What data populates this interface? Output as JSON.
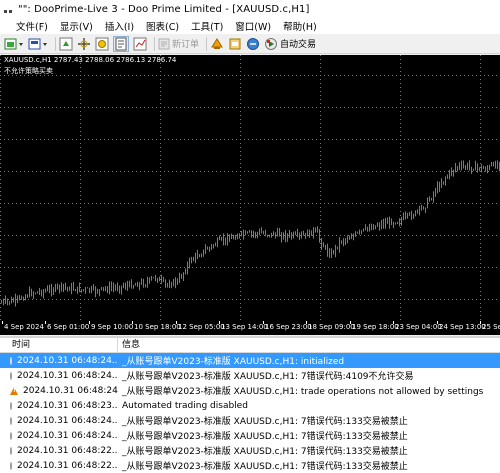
{
  "window": {
    "title": "\"\": DooPrime-Live 3 - Doo Prime Limited - [XAUUSD.c,H1]"
  },
  "menu": {
    "items": [
      "文件(F)",
      "显示(V)",
      "插入(I)",
      "图表(C)",
      "工具(T)",
      "窗口(W)",
      "帮助(H)"
    ]
  },
  "toolbar": {
    "new_order_label": "新订单",
    "autotrading_label": "自动交易"
  },
  "chart": {
    "header": "XAUUSD.c,H1  2787.43 2788.06 2786.13 2786.74",
    "subheader": "不允许策略买卖",
    "time_labels": [
      "4 Sep 2024",
      "6 Sep 01:00",
      "9 Sep 10:00",
      "10 Sep 18:00",
      "12 Sep 05:00",
      "13 Sep 14:00",
      "16 Sep 23:00",
      "18 Sep 09:00",
      "19 Sep 18:00",
      "23 Sep 04:00",
      "24 Sep 13:00",
      "25 Sep"
    ],
    "colors": {
      "background": "#000000",
      "candle": "#00d400",
      "grid": "#ffffff"
    }
  },
  "journal": {
    "col_time": "时间",
    "col_message": "信息",
    "rows": [
      {
        "time": "2024.10.31 06:48:24....",
        "message": "_从账号跟单V2023-标准版 XAUUSD.c,H1: initialized",
        "icon": "info-dot",
        "selected": true
      },
      {
        "time": "2024.10.31 06:48:24....",
        "message": "_从账号跟单V2023-标准版 XAUUSD.c,H1: 7错误代码:4109不允许交易",
        "icon": "info-dot",
        "selected": false
      },
      {
        "time": "2024.10.31 06:48:24....",
        "message": "_从账号跟单V2023-标准版 XAUUSD.c,H1: trade operations not allowed by settings",
        "icon": "warning",
        "selected": false
      },
      {
        "time": "2024.10.31 06:48:23....",
        "message": "Automated trading disabled",
        "icon": "info-dot",
        "selected": false
      },
      {
        "time": "2024.10.31 06:48:24....",
        "message": "_从账号跟单V2023-标准版 XAUUSD.c,H1: 7错误代码:133交易被禁止",
        "icon": "info-dot",
        "selected": false
      },
      {
        "time": "2024.10.31 06:48:24....",
        "message": "_从账号跟单V2023-标准版 XAUUSD.c,H1: 7错误代码:133交易被禁止",
        "icon": "info-dot",
        "selected": false
      },
      {
        "time": "2024.10.31 06:48:22....",
        "message": "_从账号跟单V2023-标准版 XAUUSD.c,H1: 7错误代码:133交易被禁止",
        "icon": "info-dot",
        "selected": false
      },
      {
        "time": "2024.10.31 06:48:22....",
        "message": "_从账号跟单V2023-标准版 XAUUSD.c,H1: 7错误代码:133交易被禁止",
        "icon": "info-dot",
        "selected": false
      }
    ]
  }
}
